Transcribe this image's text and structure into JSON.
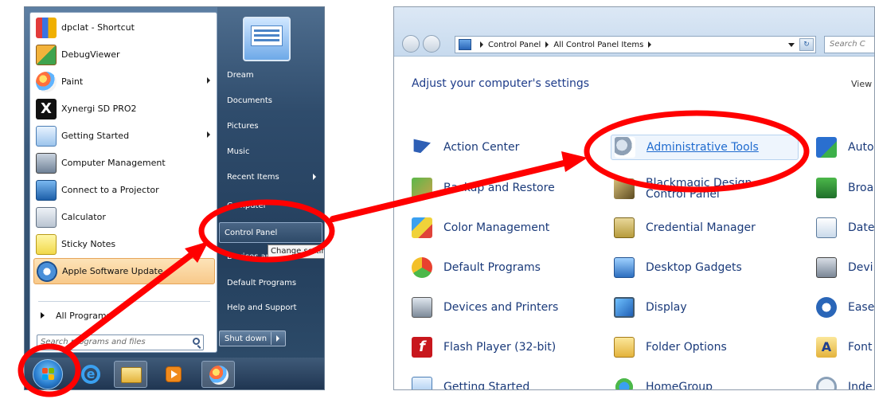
{
  "start_menu": {
    "programs": [
      {
        "label": "dpclat - Shortcut",
        "icon": "chart-icon",
        "submenu": false
      },
      {
        "label": "DebugViewer",
        "icon": "debugviewer-icon",
        "submenu": false
      },
      {
        "label": "Paint",
        "icon": "paint-icon",
        "submenu": true
      },
      {
        "label": "Xynergi SD PRO2",
        "icon": "xynergi-icon",
        "submenu": false
      },
      {
        "label": "Getting Started",
        "icon": "getting-started-icon",
        "submenu": true
      },
      {
        "label": "Computer Management",
        "icon": "computer-management-icon",
        "submenu": false
      },
      {
        "label": "Connect to a Projector",
        "icon": "projector-icon",
        "submenu": false
      },
      {
        "label": "Calculator",
        "icon": "calculator-icon",
        "submenu": false
      },
      {
        "label": "Sticky Notes",
        "icon": "sticky-notes-icon",
        "submenu": false
      },
      {
        "label": "Apple Software Update",
        "icon": "apple-update-icon",
        "submenu": false
      }
    ],
    "all_programs": "All Programs",
    "search_placeholder": "Search programs and files",
    "right_items": [
      {
        "label": "Dream",
        "submenu": false
      },
      {
        "label": "Documents",
        "submenu": false
      },
      {
        "label": "Pictures",
        "submenu": false
      },
      {
        "label": "Music",
        "submenu": false
      },
      {
        "label": "Recent Items",
        "submenu": true
      },
      {
        "label": "Computer",
        "submenu": false
      },
      {
        "label": "Control Panel",
        "submenu": false
      },
      {
        "label": "Devices and Printers",
        "submenu": false
      },
      {
        "label": "Default Programs",
        "submenu": false
      },
      {
        "label": "Help and Support",
        "submenu": false
      }
    ],
    "tooltip": "Change settings",
    "shutdown": "Shut down"
  },
  "taskbar": {
    "items": [
      "start-orb",
      "internet-explorer-icon",
      "windows-explorer-icon",
      "media-player-icon",
      "paint-icon"
    ]
  },
  "control_panel": {
    "breadcrumb": [
      "Control Panel",
      "All Control Panel Items"
    ],
    "search_placeholder": "Search C",
    "heading": "Adjust your computer's settings",
    "view_by": "View",
    "columns": [
      [
        {
          "label": "Action Center",
          "icon": "flag-icon"
        },
        {
          "label": "Backup and Restore",
          "icon": "backup-icon"
        },
        {
          "label": "Color Management",
          "icon": "color-management-icon"
        },
        {
          "label": "Default Programs",
          "icon": "default-programs-icon"
        },
        {
          "label": "Devices and Printers",
          "icon": "printer-icon"
        },
        {
          "label": "Flash Player (32-bit)",
          "icon": "flash-icon"
        },
        {
          "label": "Getting Started",
          "icon": "getting-started-icon"
        }
      ],
      [
        {
          "label": "Administrative Tools",
          "icon": "admin-tools-icon"
        },
        {
          "label": "Blackmagic Design Control Panel",
          "icon": "blackmagic-icon"
        },
        {
          "label": "Credential Manager",
          "icon": "credential-icon"
        },
        {
          "label": "Desktop Gadgets",
          "icon": "gadgets-icon"
        },
        {
          "label": "Display",
          "icon": "display-icon"
        },
        {
          "label": "Folder Options",
          "icon": "folder-options-icon"
        },
        {
          "label": "HomeGroup",
          "icon": "homegroup-icon"
        }
      ],
      [
        {
          "label": "Auto",
          "icon": "autoplay-icon"
        },
        {
          "label": "Broa",
          "icon": "broadcom-icon"
        },
        {
          "label": "Date",
          "icon": "date-time-icon"
        },
        {
          "label": "Devi",
          "icon": "device-manager-icon"
        },
        {
          "label": "Ease",
          "icon": "ease-of-access-icon"
        },
        {
          "label": "Font",
          "icon": "fonts-icon"
        },
        {
          "label": "Inde",
          "icon": "indexing-icon"
        }
      ]
    ]
  },
  "colors": {
    "annotation_red": "#ff0000",
    "link_blue": "#1a3a7a",
    "heading_blue": "#1e3c8a"
  }
}
